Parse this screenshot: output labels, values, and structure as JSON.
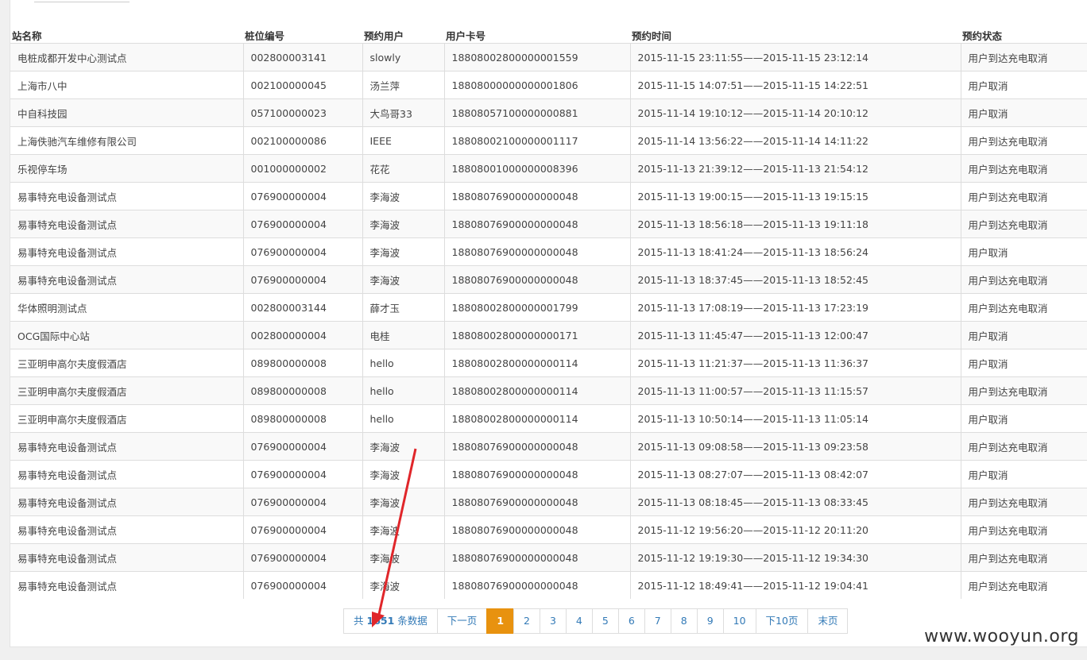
{
  "table": {
    "headers": [
      "站名称",
      "桩位编号",
      "预约用户",
      "用户卡号",
      "预约时间",
      "预约状态"
    ],
    "rows": [
      [
        "电桩成都开发中心测试点",
        "002800003141",
        "slowly",
        "18808002800000001559",
        "2015-11-15 23:11:55——2015-11-15 23:12:14",
        "用户到达充电取消"
      ],
      [
        "上海市八中",
        "002100000045",
        "汤兰萍",
        "18808000000000001806",
        "2015-11-15 14:07:51——2015-11-15 14:22:51",
        "用户取消"
      ],
      [
        "中自科技园",
        "057100000023",
        "大鸟哥33",
        "18808057100000000881",
        "2015-11-14 19:10:12——2015-11-14 20:10:12",
        "用户取消"
      ],
      [
        "上海佚驰汽车维修有限公司",
        "002100000086",
        "IEEE",
        "18808002100000001117",
        "2015-11-14 13:56:22——2015-11-14 14:11:22",
        "用户到达充电取消"
      ],
      [
        "乐视停车场",
        "001000000002",
        "花花",
        "18808001000000008396",
        "2015-11-13 21:39:12——2015-11-13 21:54:12",
        "用户到达充电取消"
      ],
      [
        "易事特充电设备测试点",
        "076900000004",
        "李海波",
        "18808076900000000048",
        "2015-11-13 19:00:15——2015-11-13 19:15:15",
        "用户到达充电取消"
      ],
      [
        "易事特充电设备测试点",
        "076900000004",
        "李海波",
        "18808076900000000048",
        "2015-11-13 18:56:18——2015-11-13 19:11:18",
        "用户到达充电取消"
      ],
      [
        "易事特充电设备测试点",
        "076900000004",
        "李海波",
        "18808076900000000048",
        "2015-11-13 18:41:24——2015-11-13 18:56:24",
        "用户取消"
      ],
      [
        "易事特充电设备测试点",
        "076900000004",
        "李海波",
        "18808076900000000048",
        "2015-11-13 18:37:45——2015-11-13 18:52:45",
        "用户到达充电取消"
      ],
      [
        "华体照明测试点",
        "002800003144",
        "薛才玉",
        "18808002800000001799",
        "2015-11-13 17:08:19——2015-11-13 17:23:19",
        "用户到达充电取消"
      ],
      [
        "OCG国际中心站",
        "002800000004",
        "电桂",
        "18808002800000000171",
        "2015-11-13 11:45:47——2015-11-13 12:00:47",
        "用户取消"
      ],
      [
        "三亚明申高尔夫度假酒店",
        "089800000008",
        "hello",
        "18808002800000000114",
        "2015-11-13 11:21:37——2015-11-13 11:36:37",
        "用户取消"
      ],
      [
        "三亚明申高尔夫度假酒店",
        "089800000008",
        "hello",
        "18808002800000000114",
        "2015-11-13 11:00:57——2015-11-13 11:15:57",
        "用户到达充电取消"
      ],
      [
        "三亚明申高尔夫度假酒店",
        "089800000008",
        "hello",
        "18808002800000000114",
        "2015-11-13 10:50:14——2015-11-13 11:05:14",
        "用户取消"
      ],
      [
        "易事特充电设备测试点",
        "076900000004",
        "李海波",
        "18808076900000000048",
        "2015-11-13 09:08:58——2015-11-13 09:23:58",
        "用户到达充电取消"
      ],
      [
        "易事特充电设备测试点",
        "076900000004",
        "李海波",
        "18808076900000000048",
        "2015-11-13 08:27:07——2015-11-13 08:42:07",
        "用户取消"
      ],
      [
        "易事特充电设备测试点",
        "076900000004",
        "李海波",
        "18808076900000000048",
        "2015-11-13 08:18:45——2015-11-13 08:33:45",
        "用户到达充电取消"
      ],
      [
        "易事特充电设备测试点",
        "076900000004",
        "李海波",
        "18808076900000000048",
        "2015-11-12 19:56:20——2015-11-12 20:11:20",
        "用户到达充电取消"
      ],
      [
        "易事特充电设备测试点",
        "076900000004",
        "李海波",
        "18808076900000000048",
        "2015-11-12 19:19:30——2015-11-12 19:34:30",
        "用户到达充电取消"
      ],
      [
        "易事特充电设备测试点",
        "076900000004",
        "李海波",
        "18808076900000000048",
        "2015-11-12 18:49:41——2015-11-12 19:04:41",
        "用户到达充电取消"
      ]
    ]
  },
  "pagination": {
    "total_prefix": "共",
    "total_count": "1651",
    "total_suffix": "条数据",
    "next_label": "下一页",
    "pages": [
      "1",
      "2",
      "3",
      "4",
      "5",
      "6",
      "7",
      "8",
      "9",
      "10"
    ],
    "active_page": "1",
    "next10_label": "下10页",
    "last_label": "末页"
  },
  "watermark": "www.wooyun.org",
  "colors": {
    "accent": "#e8920f",
    "link": "#337ab7",
    "arrow": "#e0262a"
  }
}
